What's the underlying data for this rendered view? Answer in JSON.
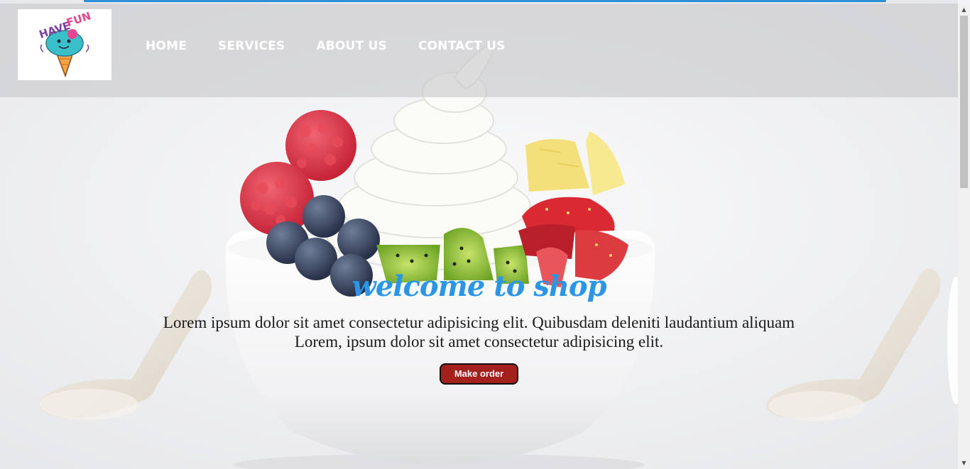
{
  "logo": {
    "text_a": "HAVE",
    "text_b": "FUN"
  },
  "nav": {
    "items": [
      {
        "label": "HOME"
      },
      {
        "label": "SERVICES"
      },
      {
        "label": "ABOUT US"
      },
      {
        "label": "CONTACT US"
      }
    ]
  },
  "hero": {
    "title": "welcome to shop",
    "line1": "Lorem ipsum dolor sit amet consectetur adipisicing elit. Quibusdam deleniti laudantium aliquam",
    "line2": "Lorem, ipsum dolor sit amet consectetur adipisicing elit.",
    "button_label": "Make order"
  },
  "colors": {
    "accent_line": "#2d90d8",
    "title": "#2b96e6",
    "button": "#a4201c"
  },
  "icons": {
    "scroll_up": "scroll-up-arrow-icon",
    "scroll_down": "scroll-down-arrow-icon"
  }
}
